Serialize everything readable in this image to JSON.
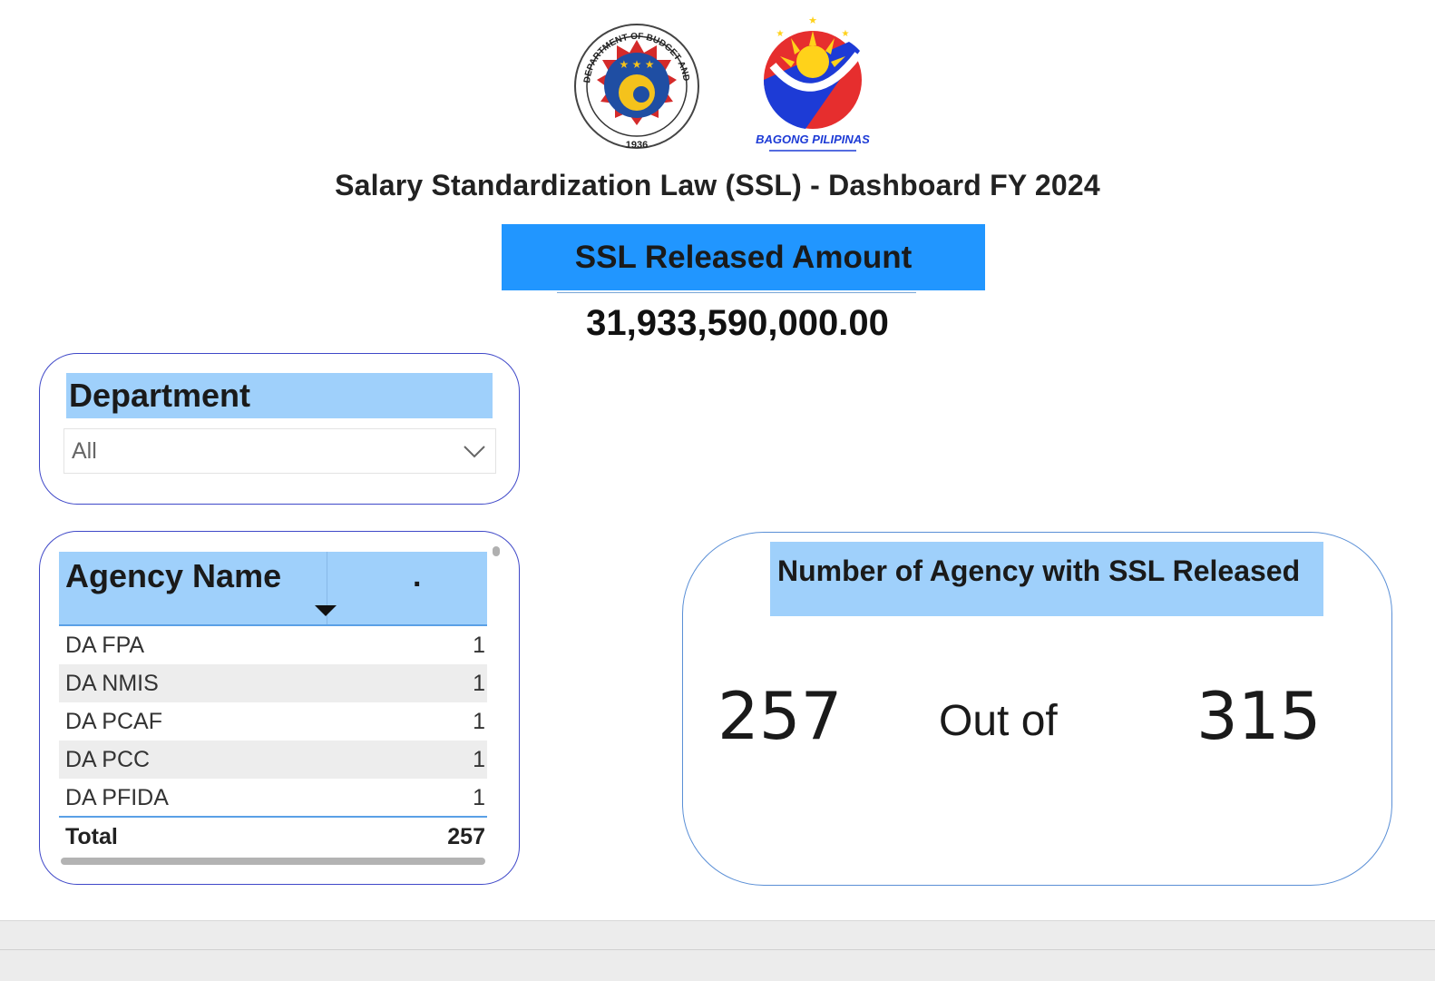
{
  "header": {
    "dbm_logo_text": "DEPARTMENT OF BUDGET AND MANAGEMENT",
    "dbm_logo_year": "1936",
    "bp_logo_text": "BAGONG PILIPINAS",
    "title": "Salary Standardization Law (SSL) - Dashboard FY 2024"
  },
  "ssl_card": {
    "label": "SSL Released Amount",
    "value": "31,933,590,000.00"
  },
  "department_filter": {
    "label": "Department",
    "selected": "All",
    "icon": "chevron-down-icon"
  },
  "agency_table": {
    "columns": [
      "Agency Name",
      "."
    ],
    "rows": [
      {
        "name": "DA FPA",
        "value": "1"
      },
      {
        "name": "DA NMIS",
        "value": "1"
      },
      {
        "name": "DA PCAF",
        "value": "1"
      },
      {
        "name": "DA PCC",
        "value": "1"
      },
      {
        "name": "DA PFIDA",
        "value": "1"
      }
    ],
    "total_label": "Total",
    "total_value": "257"
  },
  "agency_count": {
    "label": "Number of Agency with SSL Released",
    "released": "257",
    "separator": "Out of",
    "total": "315"
  },
  "colors": {
    "accent_blue": "#2196ff",
    "header_light_blue": "#9fd0fb",
    "card_border": "#3f48c8"
  }
}
